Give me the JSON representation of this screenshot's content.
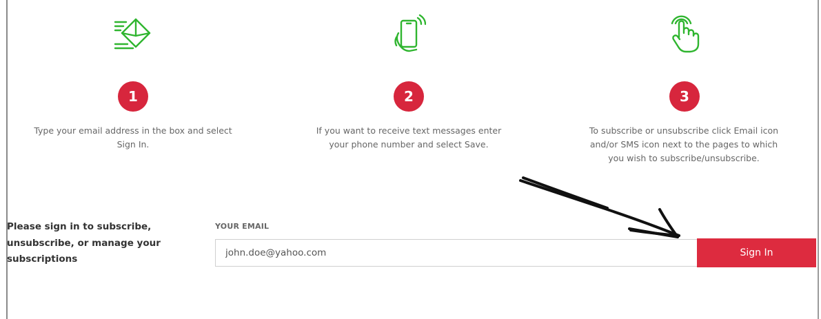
{
  "steps": [
    {
      "number": "1",
      "icon": "email-envelope-icon",
      "text_line1": "Type your email address in the box and select",
      "text_line2": "Sign In.",
      "text_line3": ""
    },
    {
      "number": "2",
      "icon": "mobile-phone-icon",
      "text_line1": "If you want to receive text messages enter",
      "text_line2": "your phone number and select Save.",
      "text_line3": ""
    },
    {
      "number": "3",
      "icon": "tap-hand-icon",
      "text_line1": "To subscribe or unsubscribe click Email icon",
      "text_line2": "and/or SMS icon next to the pages to which",
      "text_line3": "you wish to subscribe/unsubscribe."
    }
  ],
  "signin": {
    "prompt_line1": "Please sign in to subscribe,",
    "prompt_line2": "unsubscribe, or manage your",
    "prompt_line3": "subscriptions",
    "email_label": "YOUR EMAIL",
    "email_value": "john.doe@yahoo.com",
    "button_label": "Sign In"
  },
  "colors": {
    "accent_red": "#dd2b3f",
    "icon_green": "#2fb52f"
  },
  "annotation": {
    "icon": "hand-drawn-arrow-icon"
  }
}
